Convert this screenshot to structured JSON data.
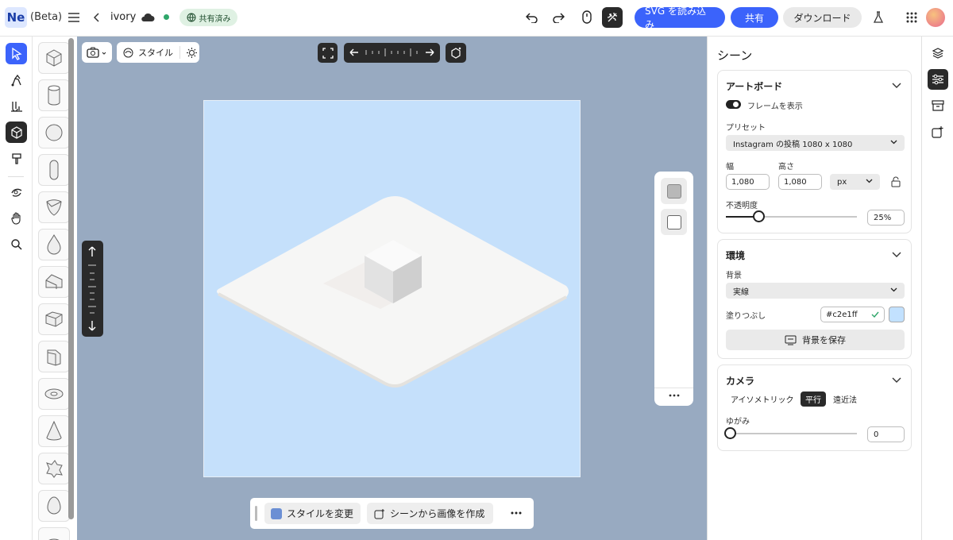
{
  "header": {
    "logo": "Ne",
    "beta": "(Beta)",
    "doc_name": "ivory",
    "shared_badge": "共有済み",
    "import_svg": "SVG を読み込み",
    "share": "共有",
    "download": "ダウンロード"
  },
  "left_tools": [
    "select-tool",
    "pen-tool",
    "draw-tool",
    "3d-objects-tool",
    "paint-tool",
    "transform-tool",
    "hand-tool",
    "zoom-tool"
  ],
  "shapes": [
    "cube",
    "cylinder",
    "sphere",
    "capsule",
    "shield",
    "drop",
    "wedge",
    "prism",
    "bevel-block",
    "torus",
    "cone",
    "star-extrude",
    "egg",
    "ring"
  ],
  "canvas_toolbar": {
    "style_label": "スタイル"
  },
  "bottom_bar": {
    "change_style": "スタイルを変更",
    "create_image": "シーンから画像を作成"
  },
  "panel": {
    "title": "シーン",
    "artboard": {
      "title": "アートボード",
      "show_frame": "フレームを表示",
      "preset_label": "プリセット",
      "preset_value": "Instagram の投稿 1080 x 1080",
      "width_label": "幅",
      "height_label": "高さ",
      "width": "1,080",
      "height": "1,080",
      "unit": "px",
      "opacity_label": "不透明度",
      "opacity": "25%",
      "opacity_fraction": 0.25
    },
    "environment": {
      "title": "環境",
      "bg_label": "背景",
      "bg_value": "実線",
      "fill_label": "塗りつぶし",
      "fill_hex": "#c2e1ff",
      "save_bg": "背景を保存"
    },
    "camera": {
      "title": "カメラ",
      "modes": [
        "アイソメトリック",
        "平行",
        "遠近法"
      ],
      "active_mode": "平行",
      "distortion_label": "ゆがみ",
      "distortion": "0"
    }
  },
  "colors": {
    "accent": "#3b63fb",
    "canvas": "#98aac1",
    "artboard": "#c5e0fb"
  }
}
